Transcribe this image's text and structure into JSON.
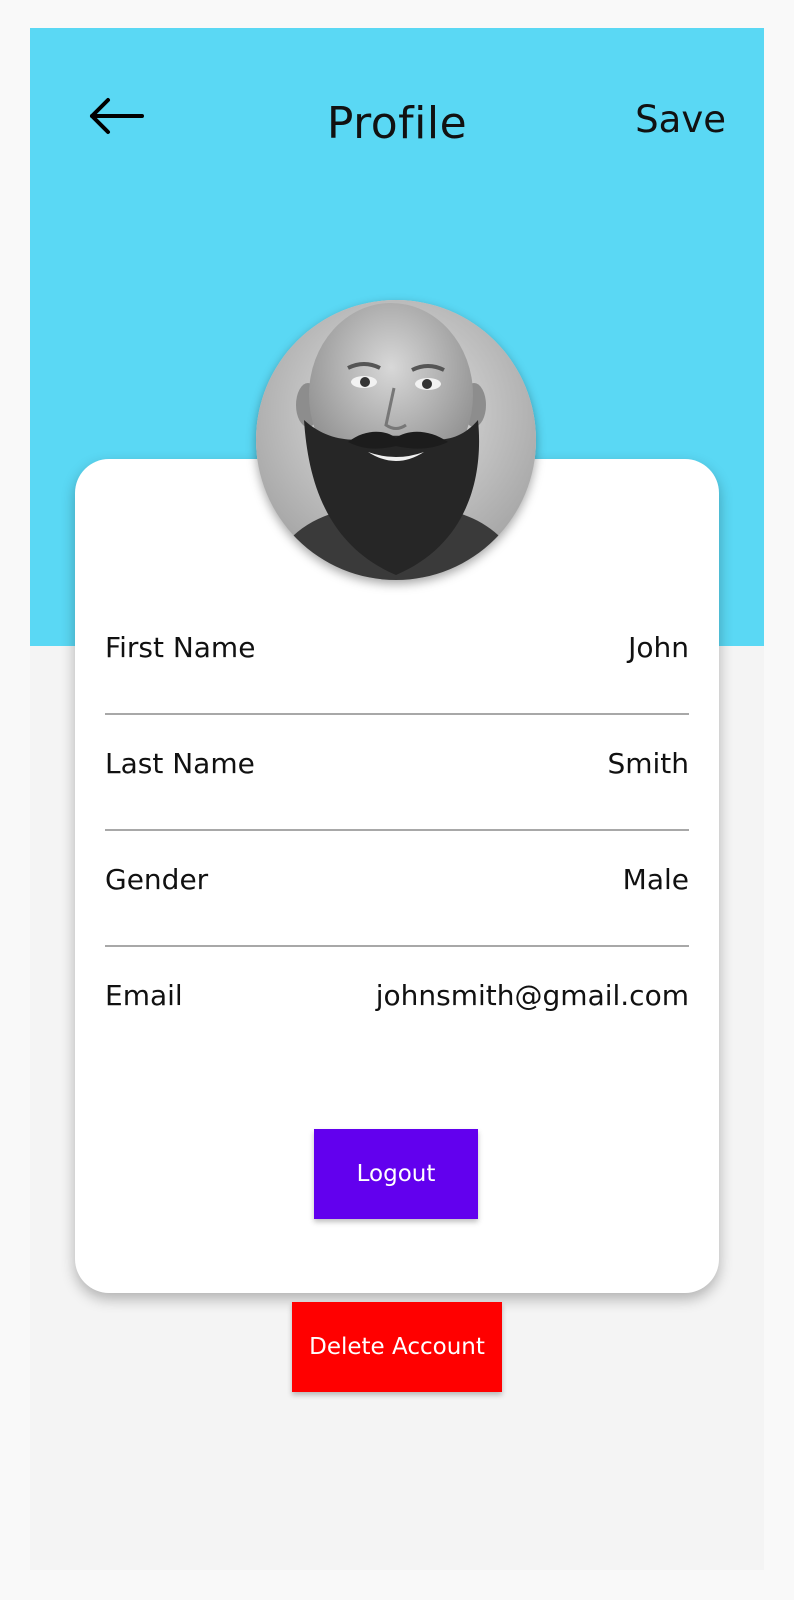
{
  "header": {
    "title": "Profile",
    "save_label": "Save",
    "back_icon": "arrow-left-icon",
    "background_color": "#5ad8f4"
  },
  "profile": {
    "fields": [
      {
        "label": "First Name",
        "value": "John"
      },
      {
        "label": "Last Name",
        "value": "Smith"
      },
      {
        "label": "Gender",
        "value": "Male"
      },
      {
        "label": "Email",
        "value": "johnsmith@gmail.com"
      }
    ]
  },
  "actions": {
    "logout_label": "Logout",
    "logout_color": "#6200ee",
    "delete_label": "Delete Account",
    "delete_color": "#ff0000"
  }
}
